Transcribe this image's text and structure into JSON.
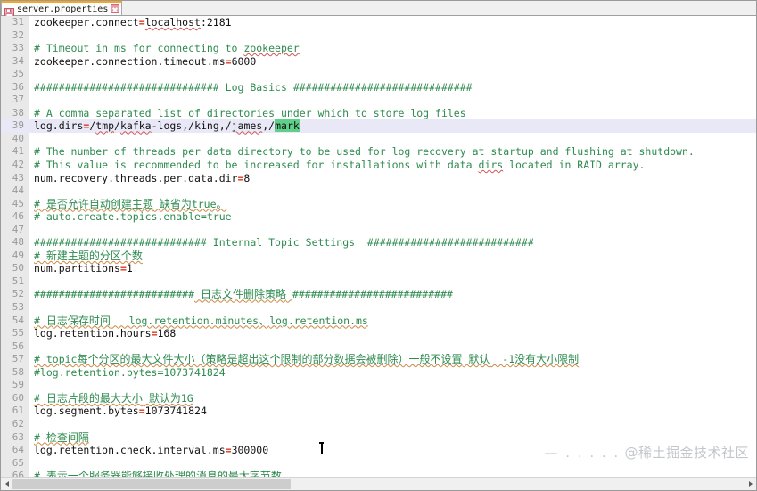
{
  "window": {
    "title": "server.properties"
  },
  "tab": {
    "label": "server.properties",
    "icon": "floppy-disk-save-icon",
    "close_label": "×",
    "accent_color": "#f5a623"
  },
  "editor": {
    "current_line": 39,
    "selection_text": "mark",
    "selection_color": "#5fd08a",
    "current_line_color": "#e8e8f7",
    "comment_color": "#2e8b4f",
    "operator_color": "#d83a22",
    "text_color": "#111111",
    "gutter_color": "#9a9a9a",
    "lines": [
      {
        "n": "31",
        "type": "kv",
        "key": "zookeeper.connect",
        "eq": "=",
        "val": "localhost:2181",
        "sq_val": "localhost"
      },
      {
        "n": "32",
        "type": "blank",
        "text": ""
      },
      {
        "n": "33",
        "type": "comment",
        "text": "# Timeout in ms for connecting to zookeeper",
        "sq": "zookeeper"
      },
      {
        "n": "34",
        "type": "kv",
        "key": "zookeeper.connection.timeout.ms",
        "eq": "=",
        "val": "6000"
      },
      {
        "n": "35",
        "type": "blank",
        "text": ""
      },
      {
        "n": "36",
        "type": "banner",
        "left": "##############################",
        "title": " Log Basics ",
        "right": "#############################"
      },
      {
        "n": "37",
        "type": "blank",
        "text": ""
      },
      {
        "n": "38",
        "type": "comment",
        "text": "# A comma separated list of directories under which to store log files"
      },
      {
        "n": "39",
        "type": "kv_sel",
        "key": "log.dirs",
        "eq": "=",
        "val_pre": "/tmp/kafka-logs,/king,/james,/",
        "val_sel": "mark",
        "sq_parts": "tmp, kafka, james"
      },
      {
        "n": "40",
        "type": "blank",
        "text": ""
      },
      {
        "n": "41",
        "type": "comment",
        "text": "# The number of threads per data directory to be used for log recovery at startup and flushing at shutdown."
      },
      {
        "n": "42",
        "type": "comment",
        "text": "# This value is recommended to be increased for installations with data dirs located in RAID array.",
        "sq": "dirs"
      },
      {
        "n": "43",
        "type": "kv",
        "key": "num.recovery.threads.per.data.dir",
        "eq": "=",
        "val": "8"
      },
      {
        "n": "44",
        "type": "blank",
        "text": ""
      },
      {
        "n": "45",
        "type": "comment_cjk",
        "text": "# 是否允许自动创建主题 缺省为true。"
      },
      {
        "n": "46",
        "type": "comment",
        "text": "# auto.create.topics.enable=true"
      },
      {
        "n": "47",
        "type": "blank",
        "text": ""
      },
      {
        "n": "48",
        "type": "banner",
        "left": "############################",
        "title": " Internal Topic Settings  ",
        "right": "###########################"
      },
      {
        "n": "49",
        "type": "comment_cjk",
        "text": "# 新建主题的分区个数"
      },
      {
        "n": "50",
        "type": "kv",
        "key": "num.partitions",
        "eq": "=",
        "val": "1"
      },
      {
        "n": "51",
        "type": "blank",
        "text": ""
      },
      {
        "n": "52",
        "type": "banner_cjk",
        "left": "##########################",
        "title": " 日志文件删除策略 ",
        "right": "##########################"
      },
      {
        "n": "53",
        "type": "blank",
        "text": ""
      },
      {
        "n": "54",
        "type": "comment_cjk",
        "text": "# 日志保存时间   log.retention.minutes、log.retention.ms"
      },
      {
        "n": "55",
        "type": "kv",
        "key": "log.retention.hours",
        "eq": "=",
        "val": "168"
      },
      {
        "n": "56",
        "type": "blank",
        "text": ""
      },
      {
        "n": "57",
        "type": "comment_cjk",
        "text": "# topic每个分区的最大文件大小（策略是超出这个限制的部分数据会被删除）一般不设置 默认  -1没有大小限制"
      },
      {
        "n": "58",
        "type": "comment",
        "text": "#log.retention.bytes=1073741824"
      },
      {
        "n": "59",
        "type": "blank",
        "text": ""
      },
      {
        "n": "60",
        "type": "comment_cjk",
        "text": "# 日志片段的最大大小 默认为1G"
      },
      {
        "n": "61",
        "type": "kv",
        "key": "log.segment.bytes",
        "eq": "=",
        "val": "1073741824"
      },
      {
        "n": "62",
        "type": "blank",
        "text": ""
      },
      {
        "n": "63",
        "type": "comment_cjk",
        "text": "# 检查间隔"
      },
      {
        "n": "64",
        "type": "kv",
        "key": "log.retention.check.interval.ms",
        "eq": "=",
        "val": "300000"
      },
      {
        "n": "65",
        "type": "blank",
        "text": ""
      },
      {
        "n": "66",
        "type": "comment_cjk",
        "text": "# 表示一个服务器能够接收处理的消息的最大字节数"
      }
    ]
  },
  "watermark": {
    "text": "@稀土掘金技术社区",
    "prefix": "— . . . . ."
  },
  "scrollbar": {
    "left_arrow": "‹",
    "right_arrow": "›",
    "thumb_percent": 38
  }
}
